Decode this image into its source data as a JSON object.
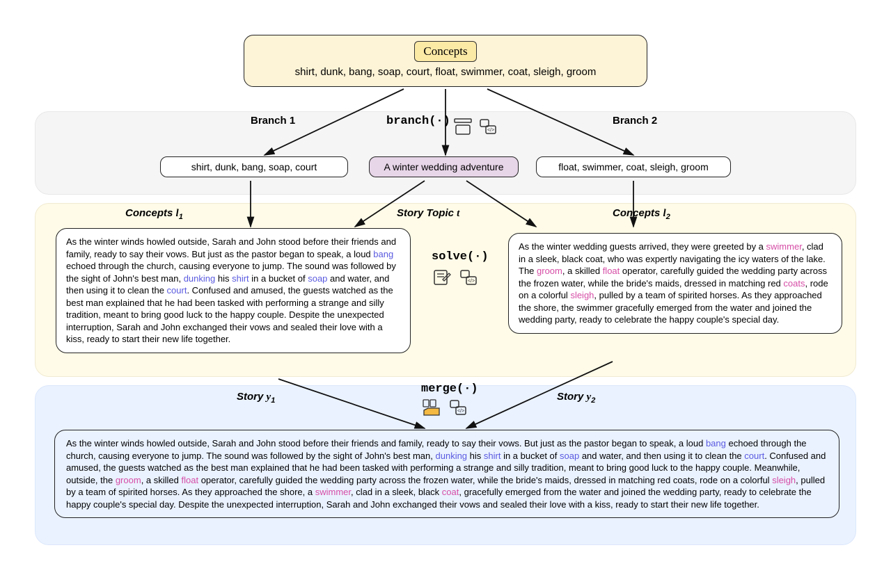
{
  "top": {
    "title": "Concepts",
    "list": "shirt, dunk, bang, soap, court, float, swimmer, coat, sleigh, groom"
  },
  "branch": {
    "label1": "Branch 1",
    "label2": "Branch 2",
    "fn": "branch(·)",
    "left_concepts": "shirt, dunk, bang, soap, court",
    "topic": "A winter wedding adventure",
    "right_concepts": "float, swimmer, coat, sleigh, groom"
  },
  "row2": {
    "concepts_l1": "Concepts ",
    "l1var": "l",
    "l1sub": "1",
    "story_topic": "Story Topic ",
    "tvar": "t",
    "concepts_l2": "Concepts ",
    "l2var": "l",
    "l2sub": "2"
  },
  "solve_fn": "solve(·)",
  "story1": {
    "t0": "As the winter winds howled outside, Sarah and John stood before their friends and family, ready to say their vows. But just as the pastor began to speak, a loud ",
    "w_bang": "bang",
    "t1": " echoed through the church, causing everyone to jump. The sound was followed by the sight of John's best man, ",
    "w_dunking": "dunking",
    "t2": " his ",
    "w_shirt": "shirt",
    "t3": " in a bucket of ",
    "w_soap": "soap",
    "t4": " and water, and then using it to clean the ",
    "w_court": "court",
    "t5": ". Confused and amused, the guests watched as the best man explained that he had been tasked with performing a strange and silly tradition, meant to bring good luck to the happy couple. Despite the unexpected interruption, Sarah and John exchanged their vows and sealed their love with a kiss, ready to start their new life together."
  },
  "story2": {
    "t0": "As the winter wedding guests arrived, they were greeted by a ",
    "w_swimmer": "swimmer",
    "t1": ", clad in a sleek, black coat, who was expertly navigating the icy waters of the lake. The ",
    "w_groom": "groom",
    "t2": ", a skilled ",
    "w_float": "float",
    "t3": " operator, carefully guided the wedding party across the frozen water, while the bride's maids, dressed in matching red ",
    "w_coats": "coats",
    "t4": ", rode on a colorful ",
    "w_sleigh": "sleigh",
    "t5": ", pulled by a team of spirited horses. As they approached the shore, the swimmer gracefully emerged from the water and joined the wedding party, ready to celebrate the happy couple's special day."
  },
  "merge": {
    "fn": "merge(·)",
    "y1": "Story ",
    "y1v": "y",
    "y1s": "1",
    "y2": "Story ",
    "y2v": "y",
    "y2s": "2"
  },
  "final": {
    "t0": "As the winter winds howled outside, Sarah and John stood before their friends and family, ready to say their vows. But just as the pastor began to speak, a loud ",
    "w_bang": "bang",
    "t1": " echoed through the church, causing everyone to jump. The sound was followed by the sight of John's best man, ",
    "w_dunking": "dunking",
    "t2": " his ",
    "w_shirt": "shirt",
    "t3": " in a bucket of ",
    "w_soap": "soap",
    "t4": " and water, and then using it to clean the ",
    "w_court": "court",
    "t5": ". Confused and amused, the guests watched as the best man explained that he had been tasked with performing a strange and silly tradition, meant to bring good luck to the happy couple. Meanwhile, outside, the ",
    "w_groom": "groom",
    "t6": ", a skilled ",
    "w_float": "float",
    "t7": " operator, carefully guided the wedding party across the frozen water, while the bride's maids, dressed in matching red coats, rode on a colorful ",
    "w_sleigh": "sleigh",
    "t8": ", pulled by a team of spirited horses. As they approached the shore, a ",
    "w_swimmer": "swimmer",
    "t9": ", clad in a sleek, black ",
    "w_coat": "coat",
    "t10": ", gracefully emerged from the water and joined the wedding party, ready to celebrate the happy couple's special day. Despite the unexpected interruption, Sarah and John exchanged their vows and sealed their love with a kiss, ready to start their new life together."
  }
}
